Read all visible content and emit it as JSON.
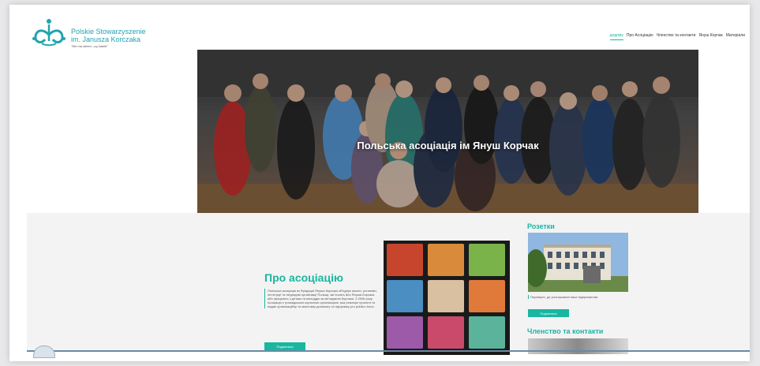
{
  "brand": {
    "line1": "Polskie Stowarzyszenie",
    "line2": "im. Janusza Korczaka",
    "tagline": "\"Nie ma dzieci—są ludzie\""
  },
  "nav": {
    "items": [
      {
        "label": "додому",
        "active": true
      },
      {
        "label": "Про Асоціацію",
        "active": false
      },
      {
        "label": "Членство та контакти",
        "active": false
      },
      {
        "label": "Януш Корчак",
        "active": false
      },
      {
        "label": "Матеріали",
        "active": false
      }
    ]
  },
  "hero": {
    "title": "Польська асоціація ім Януш Корчак"
  },
  "about": {
    "title": "Про асоціацію",
    "text": "Польська асоціація ім Фундація Януша Корчака об'єднує школи, установи, інституції та неурядові організації Польщі, які носять ім'я Януша Корчака або працюють з дітьми та молоддю за методикою Корчака. З 2006 року Асоціація є громадською корисною організацією, яка реалізує проекти та надає організаційну та змістовну допомогу та підтримку pro publico bono",
    "button": "Поділитися"
  },
  "rozetky": {
    "title": "Розетки",
    "caption": "Перевірте, де розташовані наші підприємства",
    "button": "Поділитися"
  },
  "membership": {
    "title": "Членство та контакти"
  },
  "colors": {
    "accent": "#18b7a0",
    "brand": "#20a4b0"
  }
}
